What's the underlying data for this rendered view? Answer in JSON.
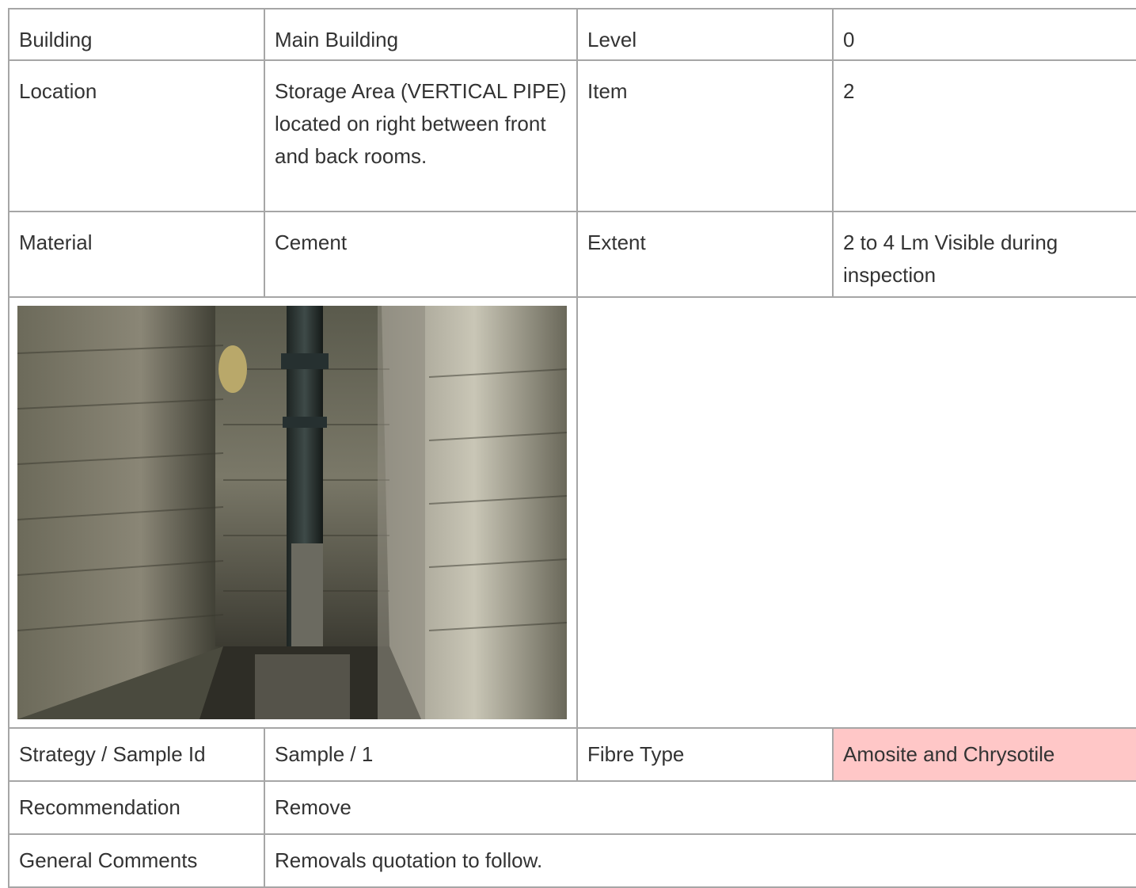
{
  "rows": {
    "building": {
      "label": "Building",
      "value": "Main Building",
      "label2": "Level",
      "value2": "0"
    },
    "location": {
      "label": "Location",
      "value": "Storage Area (VERTICAL PIPE) located on right between front and back rooms.",
      "label2": "Item",
      "value2": "2"
    },
    "material": {
      "label": "Material",
      "value": "Cement",
      "label2": "Extent",
      "value2": "2 to 4 Lm Visible during inspection"
    },
    "strategy": {
      "label": "Strategy / Sample Id",
      "value": "Sample / 1",
      "label2": "Fibre Type",
      "value2": "Amosite and Chrysotile"
    },
    "recommendation": {
      "label": "Recommendation",
      "value": "Remove"
    },
    "comments": {
      "label": "General Comments",
      "value": "Removals quotation to follow."
    }
  },
  "colors": {
    "fibre_highlight": "#ffc7c7",
    "border": "#a6a6a6"
  }
}
